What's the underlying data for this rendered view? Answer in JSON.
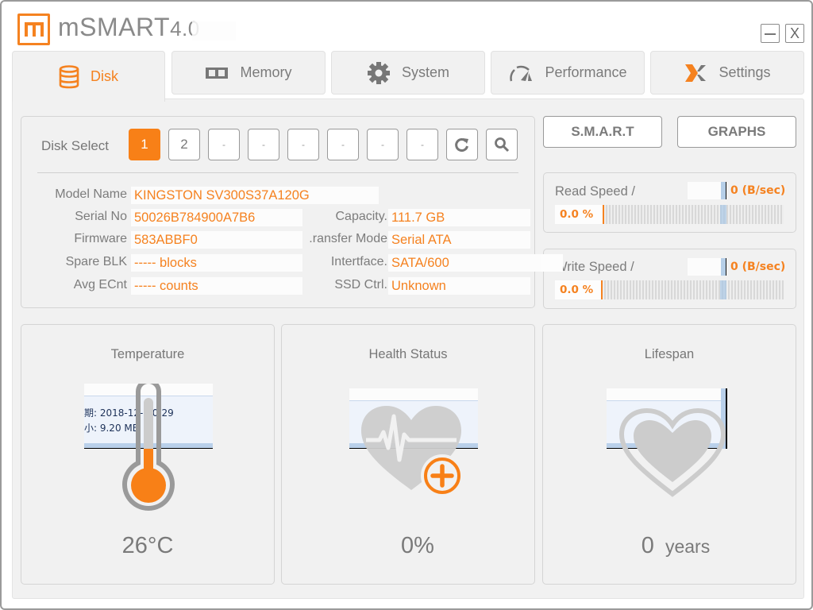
{
  "app": {
    "name": "mSMART",
    "version": "4.0",
    "brand_color": "#f58220",
    "minimize_label": "–",
    "close_label": "X"
  },
  "tabs": [
    {
      "label": "Disk",
      "icon": "database-icon",
      "active": true
    },
    {
      "label": "Memory",
      "icon": "memory-chip-icon",
      "active": false
    },
    {
      "label": "System",
      "icon": "gear-icon",
      "active": false
    },
    {
      "label": "Performance",
      "icon": "speedometer-icon",
      "active": false
    },
    {
      "label": "Settings",
      "icon": "settings-x-icon",
      "active": false
    }
  ],
  "disk_select": {
    "label": "Disk Select",
    "buttons": [
      "1",
      "2",
      "-",
      "-",
      "-",
      "-",
      "-",
      "-"
    ],
    "selected": "1",
    "refresh_icon": "refresh-icon",
    "search_icon": "search-icon"
  },
  "disk_info": {
    "model_name": {
      "label": "Model Name",
      "value": "KINGSTON SV300S37A120G"
    },
    "serial_no": {
      "label": "Serial No",
      "value": "50026B784900A7B6"
    },
    "firmware": {
      "label": "Firmware",
      "value": "583ABBF0"
    },
    "spare_blk": {
      "label": "Spare BLK",
      "value": "----- blocks"
    },
    "avg_ecnt": {
      "label": "Avg ECnt",
      "value": "----- counts"
    },
    "capacity": {
      "label": "Capacity.",
      "value": "111.7 GB"
    },
    "transfer_mode": {
      "label": "ransfer Mode.",
      "value": "Serial ATA"
    },
    "interface": {
      "label": "Intertface.",
      "value": "SATA/600"
    },
    "ssd_ctrl": {
      "label": "SSD Ctrl.",
      "value": "Unknown"
    }
  },
  "actions": {
    "smart_label": "S.M.A.R.T",
    "graphs_label": "GRAPHS"
  },
  "read_speed": {
    "label": "Read Speed /",
    "value": "0 (B/sec)",
    "percent_text": "0.0 %",
    "percent": 0.0
  },
  "write_speed": {
    "label": "Write Speed /",
    "value": "0 (B/sec)",
    "percent_text": "0.0 %",
    "percent": 0.0
  },
  "cards": {
    "temperature": {
      "title": "Temperature",
      "value": "26°C",
      "icon": "thermometer-icon"
    },
    "health": {
      "title": "Health Status",
      "value": "0%",
      "icon": "heart-pulse-plus-icon"
    },
    "lifespan": {
      "title": "Lifespan",
      "value_number": "0",
      "value_unit": "years",
      "icon": "heart-icon"
    }
  },
  "overlay_artifact": {
    "line1": "期: 2018-12-   10:29",
    "line2": "小: 9.20 MB"
  }
}
